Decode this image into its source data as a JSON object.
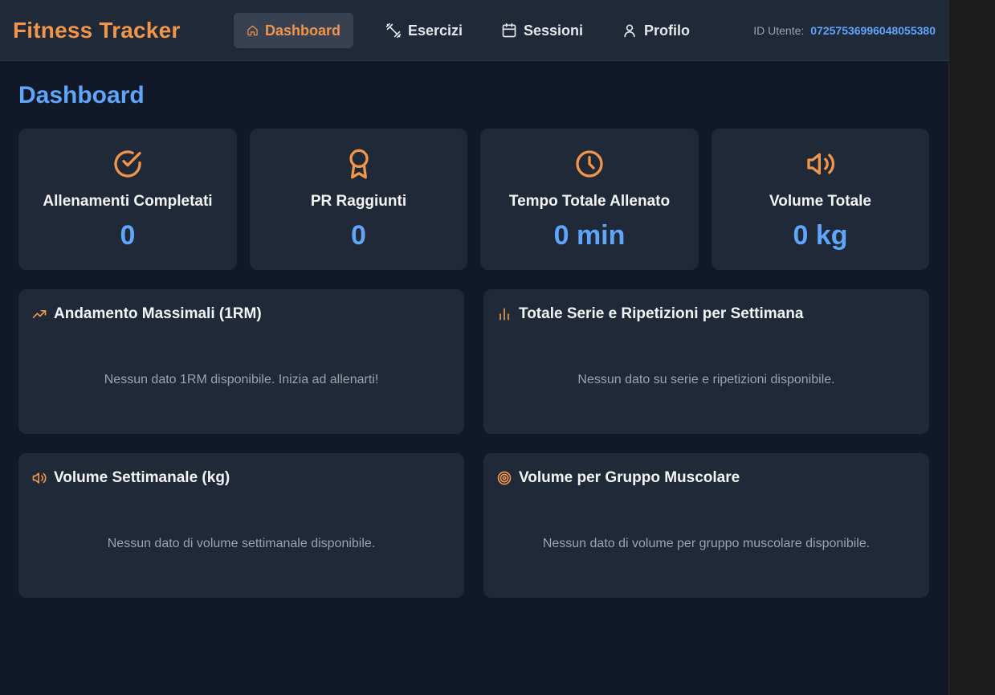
{
  "header": {
    "brand": "Fitness Tracker",
    "nav": [
      {
        "label": "Dashboard",
        "icon": "home-icon",
        "active": true
      },
      {
        "label": "Esercizi",
        "icon": "dumbbell-icon",
        "active": false
      },
      {
        "label": "Sessioni",
        "icon": "calendar-icon",
        "active": false
      },
      {
        "label": "Profilo",
        "icon": "user-icon",
        "active": false
      }
    ],
    "user_id_label": "ID Utente:",
    "user_id_value": "07257536996048055380"
  },
  "page": {
    "title": "Dashboard"
  },
  "stats": [
    {
      "label": "Allenamenti Completati",
      "value": "0",
      "icon": "check-circle-icon"
    },
    {
      "label": "PR Raggiunti",
      "value": "0",
      "icon": "award-icon"
    },
    {
      "label": "Tempo Totale Allenato",
      "value": "0 min",
      "icon": "clock-icon"
    },
    {
      "label": "Volume Totale",
      "value": "0 kg",
      "icon": "volume-icon"
    }
  ],
  "panels": [
    {
      "title": "Andamento Massimali (1RM)",
      "icon": "trending-up-icon",
      "empty": "Nessun dato 1RM disponibile. Inizia ad allenarti!"
    },
    {
      "title": "Totale Serie e Ripetizioni per Settimana",
      "icon": "bar-chart-icon",
      "empty": "Nessun dato su serie e ripetizioni disponibile."
    },
    {
      "title": "Volume Settimanale (kg)",
      "icon": "volume-icon",
      "empty": "Nessun dato di volume settimanale disponibile."
    },
    {
      "title": "Volume per Gruppo Muscolare",
      "icon": "target-icon",
      "empty": "Nessun dato di volume per gruppo muscolare disponibile."
    }
  ],
  "colors": {
    "accent": "#f0954a",
    "link": "#60a5fa",
    "background": "#111827",
    "card": "#1f2937"
  }
}
